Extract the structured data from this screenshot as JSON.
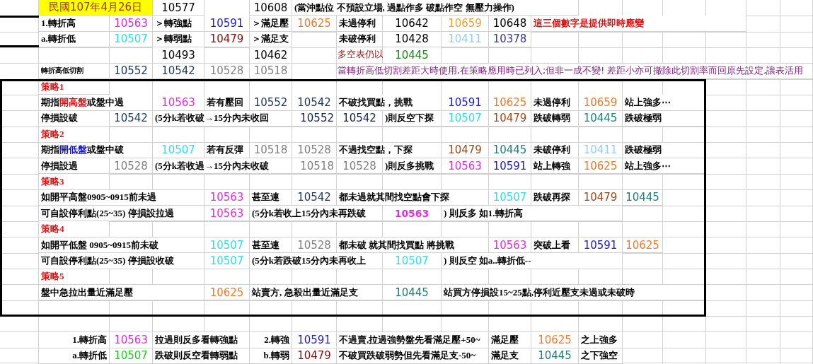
{
  "sheet": {
    "rows": [
      {
        "cells": [
          {
            "kind": "date",
            "text": "民國107年4月26日"
          },
          {
            "kind": "number",
            "text": "10577"
          },
          {
            "kind": "number",
            "text": "10608"
          },
          {
            "kind": "label",
            "text": "(當沖點位 不預設立場, 過點作多 破點作空 無壓力操作)"
          }
        ]
      },
      {
        "cells": [
          {
            "kind": "label",
            "text": "1.轉折高"
          },
          {
            "kind": "number",
            "text": "10563",
            "color": "#e030e0"
          },
          {
            "kind": "label",
            "text": "＞轉強點"
          },
          {
            "kind": "number",
            "text": "10591",
            "color": "#1a1ac8"
          },
          {
            "kind": "label",
            "text": "＞滿足壓"
          },
          {
            "kind": "number",
            "text": "10625",
            "color": "#f07a28"
          },
          {
            "kind": "label",
            "text": "未過停利"
          },
          {
            "kind": "number",
            "text": "10642"
          },
          {
            "kind": "number",
            "text": "10659",
            "color": "#f0a030"
          },
          {
            "kind": "number",
            "text": "10648"
          },
          {
            "kind": "label",
            "text": "這三個數字是提供即時應變",
            "color": "#e01010"
          }
        ]
      },
      {
        "cells": [
          {
            "kind": "label",
            "text": "a.轉折低"
          },
          {
            "kind": "number",
            "text": "10507",
            "color": "#30e0e8"
          },
          {
            "kind": "label",
            "text": "＞轉弱點"
          },
          {
            "kind": "number",
            "text": "10479",
            "color": "#801010"
          },
          {
            "kind": "label",
            "text": "＞滿足支"
          },
          {
            "kind": "number",
            "text": ""
          },
          {
            "kind": "label",
            "text": "未破停利"
          },
          {
            "kind": "number",
            "text": "10428"
          },
          {
            "kind": "number",
            "text": "10411",
            "color": "#99ccf0"
          },
          {
            "kind": "number",
            "text": "10378",
            "color": "#3a3a88"
          }
        ]
      },
      {
        "cells": [
          {
            "kind": "number",
            "text": "10493"
          },
          {
            "kind": "number",
            "text": "10462"
          },
          {
            "kind": "text",
            "text": "多空表仍以",
            "color": "#902020"
          },
          {
            "kind": "number",
            "text": "10445",
            "color": "#109010"
          }
        ]
      },
      {
        "cells": [
          {
            "kind": "small",
            "text": "轉折高低切割"
          },
          {
            "kind": "number",
            "text": "10552",
            "color": "#1f3a60"
          },
          {
            "kind": "number",
            "text": "10542",
            "color": "#1f3a60"
          },
          {
            "kind": "number",
            "text": "10528",
            "color": "#808080"
          },
          {
            "kind": "number",
            "text": "10518",
            "color": "#808080"
          },
          {
            "kind": "text",
            "text": "當轉折高低切割差距大時使用,在策略應用時已列入;但非一成不變! 差距小亦可撤除此切割率而回原先設定,讓表活用",
            "color": "#802080"
          }
        ]
      },
      {
        "cells": [
          {
            "kind": "heading",
            "text": "策略1"
          }
        ]
      },
      {
        "cells": [
          {
            "kind": "label",
            "parts": [
              {
                "text": "期指"
              },
              {
                "text": "開高盤",
                "color": "#e01010"
              },
              {
                "text": "或盤中過"
              }
            ]
          },
          {
            "kind": "number",
            "text": "10563",
            "color": "#e030e0"
          },
          {
            "kind": "label",
            "text": "若有壓回"
          },
          {
            "kind": "number",
            "text": "10552",
            "color": "#1f3a60"
          },
          {
            "kind": "number",
            "text": "10542",
            "color": "#1f3a60"
          },
          {
            "kind": "label",
            "text": "不破找買點，挑戰"
          },
          {
            "kind": "number",
            "text": "10591",
            "color": "#1a1ac8"
          },
          {
            "kind": "number",
            "text": "10625",
            "color": "#f07a28"
          },
          {
            "kind": "label",
            "text": "未過停利"
          },
          {
            "kind": "number",
            "text": "10659",
            "color": "#f07a28"
          },
          {
            "kind": "label",
            "text": "站上強多⋯"
          }
        ]
      },
      {
        "cells": [
          {
            "kind": "label",
            "text": "停損設破"
          },
          {
            "kind": "number",
            "text": "10542",
            "color": "#1f3a60"
          },
          {
            "kind": "label",
            "text": "(5分k若收破→15分內未收回"
          },
          {
            "kind": "number",
            "text": "10552",
            "color": "#102050"
          },
          {
            "kind": "number",
            "text": "10542",
            "color": "#102050"
          },
          {
            "kind": "label",
            "text": ")則反空下探"
          },
          {
            "kind": "number",
            "text": "10507",
            "color": "#30e0e8"
          },
          {
            "kind": "number",
            "text": "10479",
            "color": "#9a4a1c"
          },
          {
            "kind": "label",
            "text": "跌破轉弱"
          },
          {
            "kind": "number",
            "text": "10445",
            "color": "#1a8080"
          },
          {
            "kind": "label",
            "text": "跌破極弱"
          }
        ]
      },
      {
        "cells": [
          {
            "kind": "heading",
            "text": "策略2"
          }
        ]
      },
      {
        "cells": [
          {
            "kind": "label",
            "parts": [
              {
                "text": "期指"
              },
              {
                "text": "開低盤",
                "color": "#1010d0"
              },
              {
                "text": "或盤中破"
              }
            ]
          },
          {
            "kind": "number",
            "text": "10507",
            "color": "#30e0e8"
          },
          {
            "kind": "label",
            "text": "若有反彈"
          },
          {
            "kind": "number",
            "text": "10518",
            "color": "#808080"
          },
          {
            "kind": "number",
            "text": "10528",
            "color": "#808080"
          },
          {
            "kind": "label",
            "text": "不過找空點，下探"
          },
          {
            "kind": "number",
            "text": "10479",
            "color": "#9a4a1c"
          },
          {
            "kind": "number",
            "text": "10445",
            "color": "#1a8080"
          },
          {
            "kind": "label",
            "text": "未破停利"
          },
          {
            "kind": "number",
            "text": "10411",
            "color": "#99ccf0"
          },
          {
            "kind": "label",
            "text": "跌破極弱"
          }
        ]
      },
      {
        "cells": [
          {
            "kind": "label",
            "text": "停損設過"
          },
          {
            "kind": "number",
            "text": "10528",
            "color": "#808080"
          },
          {
            "kind": "label",
            "text": "(5分k若收過→15分內未收破"
          },
          {
            "kind": "number",
            "text": "10518",
            "color": "#808080"
          },
          {
            "kind": "number",
            "text": "10528",
            "color": "#808080"
          },
          {
            "kind": "label",
            "text": ")則反多挑戰"
          },
          {
            "kind": "number",
            "text": "10563",
            "color": "#e030e0"
          },
          {
            "kind": "number",
            "text": "10591",
            "color": "#1a1ac8"
          },
          {
            "kind": "label",
            "text": "站上轉強"
          },
          {
            "kind": "number",
            "text": "10625",
            "color": "#f07a28"
          },
          {
            "kind": "label",
            "text": "站上強多⋯"
          }
        ]
      },
      {
        "cells": [
          {
            "kind": "heading",
            "text": "策略3"
          }
        ]
      },
      {
        "cells": [
          {
            "kind": "label",
            "text": "如開平高盤0905~0915前未過"
          },
          {
            "kind": "number",
            "text": "10563",
            "color": "#e030e0"
          },
          {
            "kind": "label",
            "text": "甚至連"
          },
          {
            "kind": "number",
            "text": "10542",
            "color": "#1f3a60"
          },
          {
            "kind": "label",
            "text": "都未過就其間找空點會下探"
          },
          {
            "kind": "number",
            "text": "10507",
            "color": "#30e0e8"
          },
          {
            "kind": "label",
            "text": "跌破再探"
          },
          {
            "kind": "number",
            "text": "10479",
            "color": "#9a4a1c"
          },
          {
            "kind": "number",
            "text": "10445",
            "color": "#1a8080"
          }
        ]
      },
      {
        "cells": [
          {
            "kind": "label",
            "text": "可自設停利點(25~35) 停損設拉過"
          },
          {
            "kind": "number",
            "text": "10563",
            "color": "#e030e0"
          },
          {
            "kind": "label",
            "text": "(5分k若收上15分內未再跌破"
          },
          {
            "kind": "strong",
            "text": "10563",
            "color": "#e030e0"
          },
          {
            "kind": "label",
            "text": ") 則反多 如1.轉折高"
          }
        ]
      },
      {
        "cells": [
          {
            "kind": "heading",
            "text": "策略4"
          }
        ]
      },
      {
        "cells": [
          {
            "kind": "label",
            "text": "如開平低盤 0905~0915前未破"
          },
          {
            "kind": "number",
            "text": "10507",
            "color": "#30e0e8"
          },
          {
            "kind": "label",
            "text": "甚至連"
          },
          {
            "kind": "number",
            "text": "10528",
            "color": "#808080"
          },
          {
            "kind": "label",
            "text": "都未破 就其間找買點 將挑戰"
          },
          {
            "kind": "number",
            "text": "10563",
            "color": "#e030e0"
          },
          {
            "kind": "label",
            "text": "突破上看"
          },
          {
            "kind": "number",
            "text": "10591",
            "color": "#1a1ac8"
          },
          {
            "kind": "number",
            "text": "10625",
            "color": "#f07a28"
          }
        ]
      },
      {
        "cells": [
          {
            "kind": "label",
            "text": "可自設停利點(25~35) 停損設收破"
          },
          {
            "kind": "number",
            "text": "10507",
            "color": "#30e0e8"
          },
          {
            "kind": "label",
            "text": " (5分k若跌破15分內未再收上"
          },
          {
            "kind": "number",
            "text": "10507",
            "color": "#30e0e8"
          },
          {
            "kind": "label",
            "text": ") 則反空 如a..轉折低--"
          }
        ]
      },
      {
        "cells": [
          {
            "kind": "heading",
            "text": "策略5"
          }
        ]
      },
      {
        "cells": [
          {
            "kind": "label",
            "text": "盤中急拉出量近滿足壓"
          },
          {
            "kind": "number",
            "text": "10625",
            "color": "#f07a28"
          },
          {
            "kind": "label",
            "text": "站賣方,  急殺出量近滿足支"
          },
          {
            "kind": "number",
            "text": "10445",
            "color": "#1a8080"
          },
          {
            "kind": "label",
            "text": "站買方停損設15~25點,停利近壓支未過或未破時"
          }
        ]
      },
      {
        "cells": [
          {
            "kind": "label",
            "text": "1.轉折高"
          },
          {
            "kind": "number",
            "text": "10563",
            "color": "#e030e0"
          },
          {
            "kind": "label",
            "text": "拉過則反多看轉強點"
          },
          {
            "kind": "label",
            "text": "2.轉強"
          },
          {
            "kind": "number",
            "text": "10591",
            "color": "#1a1ac8"
          },
          {
            "kind": "label",
            "text": "不過賣,拉過強勢盤先看滿足壓+50~"
          },
          {
            "kind": "label",
            "text": "滿足壓"
          },
          {
            "kind": "number",
            "text": "10625",
            "color": "#f07a28"
          },
          {
            "kind": "label",
            "text": "之上強多"
          }
        ]
      },
      {
        "cells": [
          {
            "kind": "label",
            "text": "a.轉折低"
          },
          {
            "kind": "number",
            "text": "10507",
            "color": "#20d020"
          },
          {
            "kind": "label",
            "text": "跌破則反空看轉弱點"
          },
          {
            "kind": "label",
            "text": "b.轉弱"
          },
          {
            "kind": "number",
            "text": "10479",
            "color": "#801010"
          },
          {
            "kind": "label",
            "text": "不破買跌破弱勢但先看滿足支-50~"
          },
          {
            "kind": "label",
            "text": "滿足支"
          },
          {
            "kind": "number",
            "text": "10445",
            "color": "#1a8080"
          },
          {
            "kind": "label",
            "text": "之下強空"
          }
        ]
      }
    ]
  }
}
